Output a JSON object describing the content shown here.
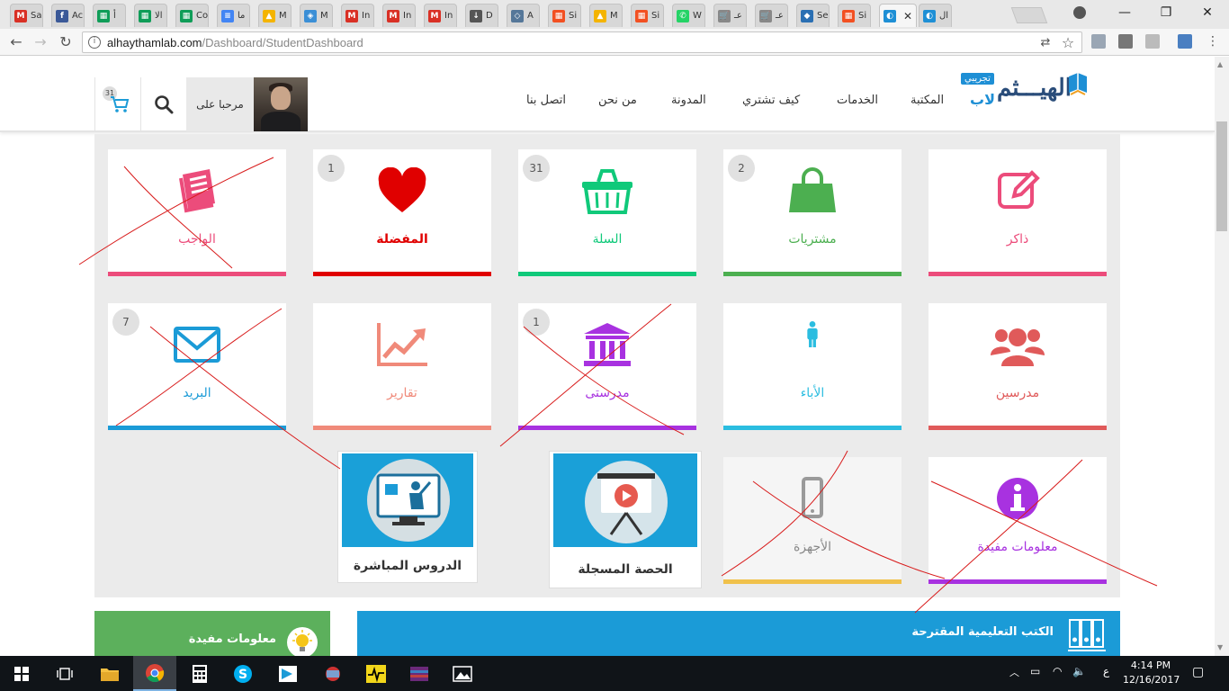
{
  "browser": {
    "tabs": [
      {
        "title": "Sa",
        "color": "#d93025",
        "glyph": "M"
      },
      {
        "title": "Ac",
        "color": "#3b5998",
        "glyph": "f"
      },
      {
        "title": "أ",
        "color": "#0f9d58",
        "glyph": "▦"
      },
      {
        "title": "الا",
        "color": "#0f9d58",
        "glyph": "▦"
      },
      {
        "title": "Co",
        "color": "#0f9d58",
        "glyph": "▦"
      },
      {
        "title": "ما",
        "color": "#4285f4",
        "glyph": "≡"
      },
      {
        "title": "M",
        "color": "#f4b400",
        "glyph": "▲"
      },
      {
        "title": "M",
        "color": "#3b8fd6",
        "glyph": "◈"
      },
      {
        "title": "In",
        "color": "#d93025",
        "glyph": "M"
      },
      {
        "title": "In",
        "color": "#d93025",
        "glyph": "M"
      },
      {
        "title": "In",
        "color": "#d93025",
        "glyph": "M"
      },
      {
        "title": "D",
        "color": "#555555",
        "glyph": "↓"
      },
      {
        "title": "A",
        "color": "#557799",
        "glyph": "◇"
      },
      {
        "title": "Si",
        "color": "#f25022",
        "glyph": "▦"
      },
      {
        "title": "M",
        "color": "#f4b400",
        "glyph": "▲"
      },
      {
        "title": "Si",
        "color": "#f25022",
        "glyph": "▦"
      },
      {
        "title": "W",
        "color": "#25d366",
        "glyph": "✆"
      },
      {
        "title": "عـ",
        "color": "#888888",
        "glyph": "🛒"
      },
      {
        "title": "عـ",
        "color": "#888888",
        "glyph": "🛒"
      },
      {
        "title": "Se",
        "color": "#2a6fb3",
        "glyph": "◆"
      },
      {
        "title": "Si",
        "color": "#f25022",
        "glyph": "▦"
      },
      {
        "title": "",
        "color": "#1e8fd5",
        "glyph": "◐",
        "active": true
      },
      {
        "title": "ال",
        "color": "#1e8fd5",
        "glyph": "◐"
      }
    ],
    "close_tab_label": "✕",
    "url_host": "alhaythamlab.com",
    "url_path": "/Dashboard/StudentDashboard",
    "back_label": "←",
    "forward_label": "→",
    "reload_label": "↻",
    "info_label": "i",
    "translate_label": "⇄",
    "star_label": "☆",
    "minimize_label": "—",
    "maximize_label": "❐",
    "close_label": "✕"
  },
  "header": {
    "logo_trial": "تجريبي",
    "logo_lab": "لاب",
    "logo_name": "الهيـــثم",
    "menu": [
      "المكتبة",
      "الخدمات",
      "كيف تشتري",
      "المدونة",
      "من نحن",
      "اتصل بنا"
    ],
    "greeting": "مرحبا على",
    "cart_count": "31"
  },
  "cards": [
    {
      "label": "ذاكر",
      "color": "#ec4c7b",
      "icon": "edit-icon",
      "badge": ""
    },
    {
      "label": "مشتريات",
      "color": "#4caf50",
      "icon": "shopping-bag-icon",
      "badge": "2"
    },
    {
      "label": "السلة",
      "color": "#10c97a",
      "icon": "basket-icon",
      "badge": "31"
    },
    {
      "label": "المفضلة",
      "color": "#e00000",
      "icon": "heart-icon",
      "badge": "1"
    },
    {
      "label": "الواجب",
      "color": "#ec4c7b",
      "icon": "book-icon",
      "badge": ""
    },
    {
      "label": "مدرسين",
      "color": "#e05a5a",
      "icon": "users-icon",
      "badge": ""
    },
    {
      "label": "الأباء",
      "color": "#2bbde0",
      "icon": "person-icon",
      "badge": ""
    },
    {
      "label": "مدرستى",
      "color": "#a832e0",
      "icon": "school-icon",
      "badge": "1"
    },
    {
      "label": "تقارير",
      "color": "#f08a7a",
      "icon": "chart-line-icon",
      "badge": ""
    },
    {
      "label": "البريد",
      "color": "#1b9bd7",
      "icon": "mail-icon",
      "badge": "7"
    },
    {
      "label": "معلومات مفيدة",
      "color": "#a832e0",
      "icon": "info-icon",
      "badge": ""
    },
    {
      "label": "الأجهزة",
      "color": "#f0c14b",
      "icon": "phone-icon",
      "badge": ""
    }
  ],
  "posters": [
    {
      "label": "الحصة المسجلة",
      "icon": "video-board-icon"
    },
    {
      "label": "الدروس المباشرة",
      "icon": "live-lesson-icon"
    }
  ],
  "bottom": {
    "useful_info": "معلومات مفيدة",
    "suggested_books": "الكتب التعليمية المقترحة"
  },
  "taskbar": {
    "lang": "ع",
    "time": "4:14 PM",
    "date": "12/16/2017"
  }
}
